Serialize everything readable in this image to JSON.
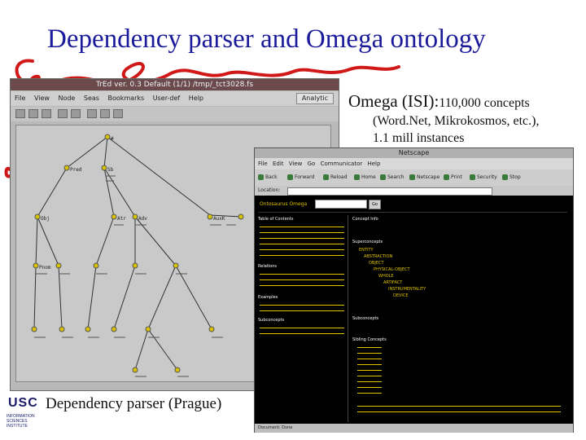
{
  "slide": {
    "title": "Dependency parser and Omega ontology",
    "omega_title_main": "Omega (ISI):",
    "omega_title_count": "110,000 concepts",
    "omega_sub1": "(Word.Net, Mikrokosmos, etc.),",
    "omega_sub2": "1.1 mill instances",
    "caption": "Dependency parser (Prague)",
    "logo_text": "USC",
    "logo_sub": "INFORMATION SCIENCES INSTITUTE",
    "accent_color": "#1a1a9a",
    "squiggle_color": "#d01818"
  },
  "tred": {
    "titlebar": "TrEd ver. 0.3  Default (1/1) /tmp/_tct3028.fs",
    "menu": [
      "File",
      "View",
      "Node",
      "Seas",
      "Bookmarks",
      "User-def",
      "Help"
    ],
    "style_label": "Analytic",
    "tree_nodes": [
      {
        "id": "root",
        "label": "#"
      },
      {
        "id": "n1",
        "label": "Pred"
      },
      {
        "id": "n2",
        "label": "Sb"
      },
      {
        "id": "n3",
        "label": "Obj"
      },
      {
        "id": "n4",
        "label": "Atr"
      },
      {
        "id": "n5",
        "label": "Adv"
      },
      {
        "id": "n6",
        "label": "Pnom"
      },
      {
        "id": "n7",
        "label": "AuxK"
      }
    ]
  },
  "omega": {
    "titlebar": "Netscape",
    "menu": [
      "File",
      "Edit",
      "View",
      "Go",
      "Communicator",
      "Help"
    ],
    "nav": [
      "Back",
      "Forward",
      "Reload",
      "Home",
      "Search",
      "Netscape",
      "Print",
      "Security",
      "Stop"
    ],
    "location_label": "Location:",
    "search_label": "Ontosaurus Omega",
    "search_value": "",
    "go_label": "Go",
    "left_sections": [
      "Table of Contents",
      "Relations",
      "Examples",
      "Subconcepts"
    ],
    "right_sections": [
      "Concept Info",
      "Superconcepts",
      "Subconcepts",
      "Sibling Concepts"
    ],
    "right_links": [
      "ENTITY",
      "ABSTRACTION",
      "OBJECT",
      "PHYSICAL-OBJECT",
      "WHOLE",
      "ARTIFACT",
      "INSTRUMENTALITY",
      "DEVICE"
    ],
    "status": "Document: Done"
  }
}
